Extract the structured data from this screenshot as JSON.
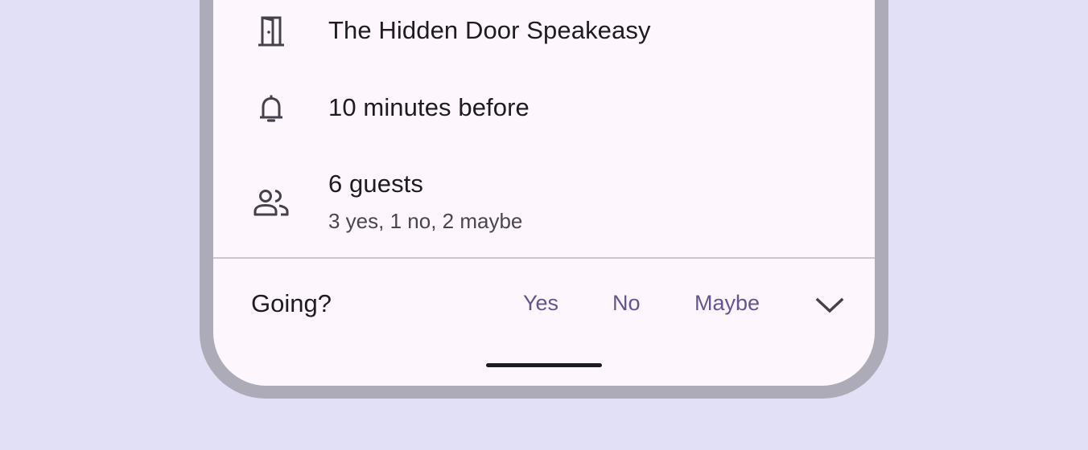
{
  "event": {
    "location": "The Hidden Door Speakeasy",
    "reminder": "10 minutes before",
    "guests": {
      "title": "6 guests",
      "summary": "3 yes, 1 no, 2 maybe"
    }
  },
  "rsvp": {
    "prompt": "Going?",
    "yes_label": "Yes",
    "no_label": "No",
    "maybe_label": "Maybe"
  },
  "icons": {
    "location": "door-icon",
    "reminder": "bell-icon",
    "guests": "people-icon",
    "expand": "chevron-down-icon"
  },
  "colors": {
    "background": "#e2e0f6",
    "frame": "#acabb7",
    "surface": "#fdf7fd",
    "primary_text": "#1e1b21",
    "secondary_text": "#4a4650",
    "accent": "#65558f"
  }
}
